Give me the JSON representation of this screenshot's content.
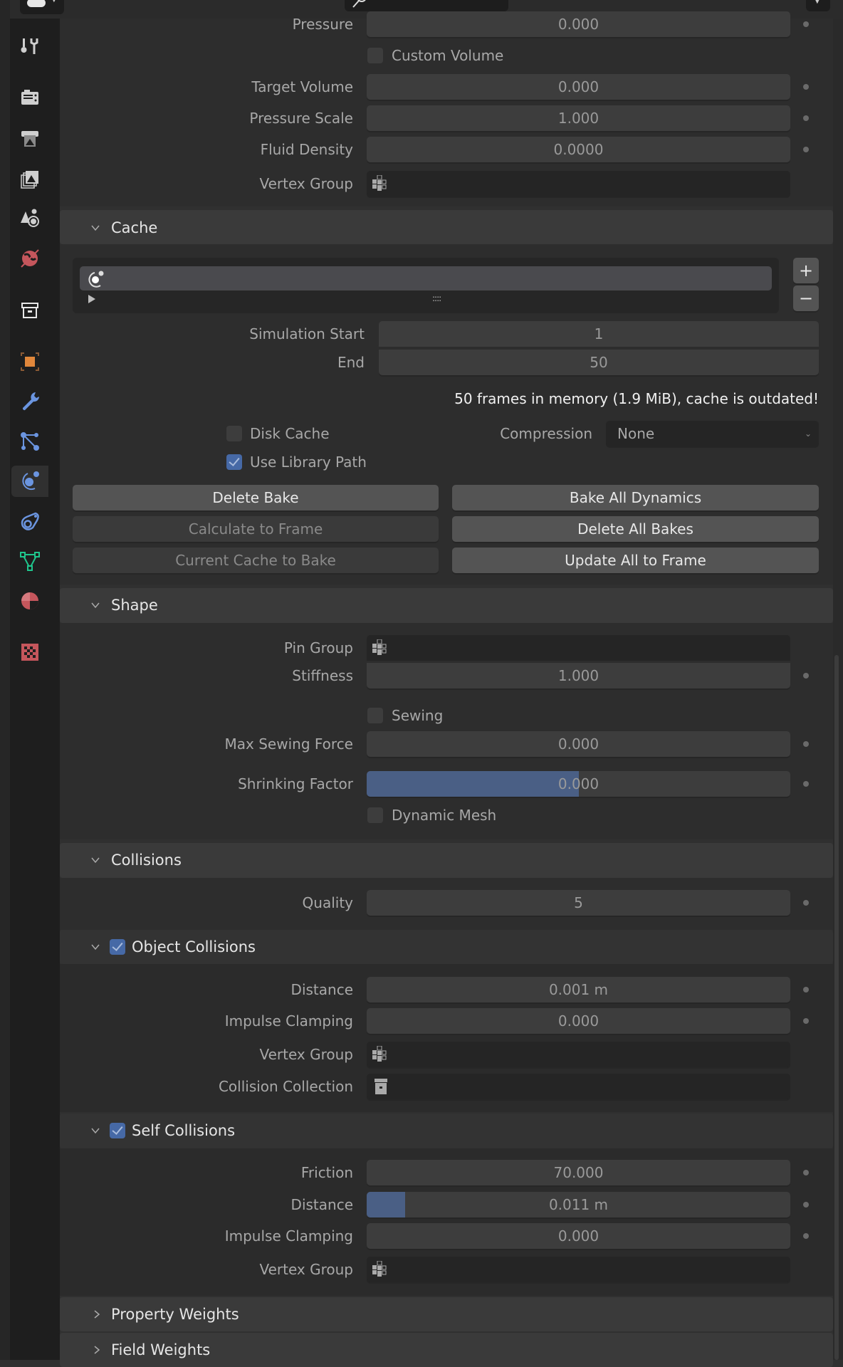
{
  "header": {
    "editor_type_icon": "toggle-icon",
    "search_icon": "search-icon"
  },
  "sidebar": {
    "tabs": [
      {
        "name": "tool",
        "icon": "tool-icon",
        "color": "#cfcfcf"
      },
      {
        "name": "render",
        "icon": "render-icon",
        "color": "#cfcfcf"
      },
      {
        "name": "output",
        "icon": "output-icon",
        "color": "#cfcfcf"
      },
      {
        "name": "view-layer",
        "icon": "view-layer-icon",
        "color": "#cfcfcf"
      },
      {
        "name": "scene",
        "icon": "scene-icon",
        "color": "#cfcfcf"
      },
      {
        "name": "world",
        "icon": "world-icon",
        "color": "#c5565c"
      },
      {
        "name": "collection",
        "icon": "collection-icon",
        "color": "#e8e8e8"
      },
      {
        "name": "object",
        "icon": "object-icon",
        "color": "#e1873b"
      },
      {
        "name": "modifiers",
        "icon": "wrench-icon",
        "color": "#6b95e0"
      },
      {
        "name": "particles",
        "icon": "particles-icon",
        "color": "#6b95e0"
      },
      {
        "name": "physics",
        "icon": "physics-icon",
        "color": "#6b95e0",
        "active": true
      },
      {
        "name": "constraints",
        "icon": "constraints-icon",
        "color": "#6b95e0"
      },
      {
        "name": "data",
        "icon": "mesh-data-icon",
        "color": "#1fc58c"
      },
      {
        "name": "material",
        "icon": "material-icon",
        "color": "#c5565c"
      },
      {
        "name": "texture",
        "icon": "texture-icon",
        "color": "#c5565c"
      }
    ]
  },
  "pressure": {
    "pressure": {
      "label": "Pressure",
      "value": "0.000"
    },
    "custom_volume": {
      "label": "Custom Volume",
      "checked": false
    },
    "target_volume": {
      "label": "Target Volume",
      "value": "0.000"
    },
    "pressure_scale": {
      "label": "Pressure Scale",
      "value": "1.000"
    },
    "fluid_density": {
      "label": "Fluid Density",
      "value": "0.0000"
    },
    "vertex_group": {
      "label": "Vertex Group",
      "value": ""
    }
  },
  "cache": {
    "title": "Cache",
    "add_label": "+",
    "remove_label": "−",
    "grip": "::::",
    "simulation_start": {
      "label": "Simulation Start",
      "value": "1"
    },
    "end": {
      "label": "End",
      "value": "50"
    },
    "status": "50 frames in memory (1.9 MiB), cache is outdated!",
    "disk_cache": {
      "label": "Disk Cache",
      "checked": false
    },
    "use_library_path": {
      "label": "Use Library Path",
      "checked": true
    },
    "compression": {
      "label": "Compression",
      "value": "None"
    },
    "buttons": {
      "delete_bake": "Delete Bake",
      "bake_all_dynamics": "Bake All Dynamics",
      "calculate_to_frame": "Calculate to Frame",
      "delete_all_bakes": "Delete All Bakes",
      "current_cache_to_bake": "Current Cache to Bake",
      "update_all_to_frame": "Update All to Frame"
    }
  },
  "shape": {
    "title": "Shape",
    "pin_group": {
      "label": "Pin Group",
      "value": ""
    },
    "stiffness": {
      "label": "Stiffness",
      "value": "1.000"
    },
    "sewing": {
      "label": "Sewing",
      "checked": false
    },
    "max_sewing_force": {
      "label": "Max Sewing Force",
      "value": "0.000"
    },
    "shrinking_factor": {
      "label": "Shrinking Factor",
      "value": "0.000",
      "slider_fraction": 0.5
    },
    "dynamic_mesh": {
      "label": "Dynamic Mesh",
      "checked": false
    }
  },
  "collisions": {
    "title": "Collisions",
    "quality": {
      "label": "Quality",
      "value": "5"
    },
    "object_collisions": {
      "title": "Object Collisions",
      "enabled": true,
      "distance": {
        "label": "Distance",
        "value": "0.001 m"
      },
      "impulse_clamping": {
        "label": "Impulse Clamping",
        "value": "0.000"
      },
      "vertex_group": {
        "label": "Vertex Group",
        "value": ""
      },
      "collision_collection": {
        "label": "Collision Collection",
        "value": ""
      }
    },
    "self_collisions": {
      "title": "Self Collisions",
      "enabled": true,
      "friction": {
        "label": "Friction",
        "value": "70.000"
      },
      "distance": {
        "label": "Distance",
        "value": "0.011 m",
        "slider_fraction": 0.09
      },
      "impulse_clamping": {
        "label": "Impulse Clamping",
        "value": "0.000"
      },
      "vertex_group": {
        "label": "Vertex Group",
        "value": ""
      }
    }
  },
  "collapsed_sections": {
    "property_weights": "Property Weights",
    "field_weights": "Field Weights"
  }
}
